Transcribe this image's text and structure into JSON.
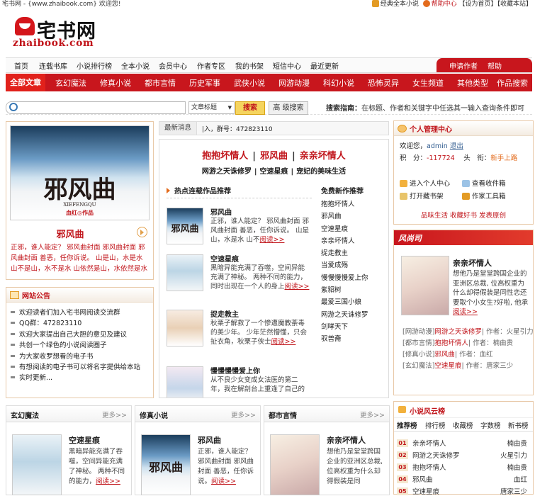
{
  "topbar": {
    "site_text": "宅书网 - {www.zhaibook.com} 欢迎您!",
    "links": [
      "经典全本小说",
      "帮助中心",
      "【设为首页】",
      "【收藏本站】"
    ]
  },
  "logo": {
    "cn": "宅书网",
    "en": "zhaibook.com"
  },
  "nav1": {
    "items": [
      "首页",
      "连载书库",
      "小说排行榜",
      "全本小说",
      "会员中心",
      "作者专区",
      "我的书架",
      "短信中心",
      "最近更新"
    ],
    "right": [
      "申请作者",
      "帮助"
    ]
  },
  "nav2": {
    "items": [
      "全部文章",
      "玄幻魔法",
      "修真小说",
      "都市言情",
      "历史军事",
      "武侠小说",
      "网游动漫",
      "科幻小说",
      "恐怖灵异",
      "女生频道",
      "其他类型",
      "作品搜索"
    ]
  },
  "search": {
    "input_value": "",
    "select_value": "文章标题",
    "search_btn": "搜索",
    "advanced_btn": "高 级搜索",
    "guide_label": "搜索指南：",
    "guide_text": "在标题、作者和关键字中任选其一输入查询条件即可"
  },
  "featured": {
    "cover_title": "邪风曲",
    "cover_sub": "XIEFENGQU",
    "cover_author": "血红◎作品",
    "name": "邪风曲",
    "desc": "正邪，谁人能定？ 邪风曲封面 邪风曲封面 邪风曲封面 善恶，任你诉说。 山是山，水是水 山不是山，水不是水 山依然是山，水依然是水"
  },
  "notice": {
    "title": "网站公告",
    "items": [
      "欢迎读者们加入宅书网阅读交流群",
      "QQ群：472823110",
      "欢迎大家提出自己大胆的意见及建议",
      "共创一个绿色的小说阅读圈子",
      "为大家收罗想看的电子书",
      "有想阅读的电子书可以将名字提供给本站",
      "实时更新..."
    ]
  },
  "newsbar": {
    "label": "最新消息",
    "text": "|入，群号：472823110"
  },
  "center": {
    "headline": [
      "抱抱坏情人",
      "邪风曲",
      "亲亲坏情人"
    ],
    "subline": [
      "网游之天诛修罗",
      "空速星痕",
      "宠妃的美味生活"
    ],
    "section_title": "热点连载作品推荐",
    "books": [
      {
        "name": "邪风曲",
        "desc": "正邪，谁人能定？ 邪风曲封面 邪风曲封面 善恶，任你诉说。 山是山，水是水 山不",
        "more": "阅读>>"
      },
      {
        "name": "空速星痕",
        "desc": "黑暗异能充满了吞噬，空间异能充满了神秘。 两种不同的能力，同时出现在一个人的身上",
        "more": "阅读>>"
      },
      {
        "name": "捉走教主",
        "desc": "秋栗子解救了一个惨遭魔教荼毒的美少年。 少年茫然懵懂，只会扯衣角，秋栗子侠士",
        "more": "阅读>>"
      },
      {
        "name": "慢慢慢慢爱上你",
        "desc": "从不良少女变成女法医的第二年，我在解剖台上重逢了自己的",
        "more": ""
      }
    ],
    "free_title": "免费新作推荐",
    "free_items": [
      "抱抱坏情人",
      "邪风曲",
      "空速星痕",
      "亲亲坏情人",
      "捉走教主",
      "当爱成殇",
      "慢慢慢慢爱上你",
      "紫貂树",
      "最爱三国小娘",
      "网游之天诛修罗",
      "剑哮天下",
      "驭兽斋"
    ]
  },
  "user": {
    "title": "个人管理中心",
    "welcome_label": "欢迎您，",
    "username": "admin",
    "logout": "退出",
    "points_label": "积　分：",
    "points": "-117724",
    "rank_label": "头　衔：",
    "rank": "新手上路",
    "tools": [
      "进入个人中心",
      "查看收件箱",
      "打开藏书架",
      "作家工具箱"
    ],
    "links": "品味生活  收藏好书  发表原创"
  },
  "recbox": {
    "logo": "风尚司",
    "name": "亲亲坏情人",
    "desc": "想他乃是堂堂跨国企业的亚洲区总裁, 位高权重为什么却得假装是同性恋还要取个小女生?好啦, 他承",
    "more": "阅读>>",
    "lines": [
      {
        "cat": "[网游动漫]",
        "book": "网游之天诛修罗",
        "author_label": "| 作者：",
        "author": "火星引力"
      },
      {
        "cat": "[都市言情]",
        "book": "抱抱坏情人",
        "author_label": "| 作者：",
        "author": "楠由贵"
      },
      {
        "cat": "[修真小说]",
        "book": "邪风曲",
        "author_label": "| 作者：",
        "author": "血红"
      },
      {
        "cat": "[玄幻魔法]",
        "book": "空速星痕",
        "author_label": "| 作者：",
        "author": "唐家三少"
      }
    ]
  },
  "catboxes": [
    {
      "title": "玄幻魔法",
      "more": "更多>>",
      "name": "空速星痕",
      "desc": "黑暗异能充满了吞噬，空间异能充满了神秘。 两种不同的能力，",
      "read": "阅读>>"
    },
    {
      "title": "修真小说",
      "more": "更多>>",
      "name": "邪风曲",
      "desc": "正邪，谁人能定？ 邪风曲封面 邪风曲封面 善恶，任你诉说。",
      "read": "阅读>>"
    },
    {
      "title": "都市言情",
      "more": "更多>>",
      "name": "亲亲坏情人",
      "desc": "想他乃是堂堂跨国企业的亚洲区总裁, 位高权重为什么却得假装是同",
      "read": ""
    }
  ],
  "rank": {
    "title": "小说风云榜",
    "tabs": [
      "推荐榜",
      "排行榜",
      "收藏榜",
      "字数榜",
      "新书榜"
    ],
    "rows": [
      {
        "num": "01",
        "name": "亲亲坏情人",
        "author": "楠由贵"
      },
      {
        "num": "02",
        "name": "网游之天诛修罗",
        "author": "火星引力"
      },
      {
        "num": "03",
        "name": "抱抱坏情人",
        "author": "楠由贵"
      },
      {
        "num": "04",
        "name": "邪风曲",
        "author": "血红"
      },
      {
        "num": "05",
        "name": "空速星痕",
        "author": "唐家三少"
      }
    ]
  }
}
